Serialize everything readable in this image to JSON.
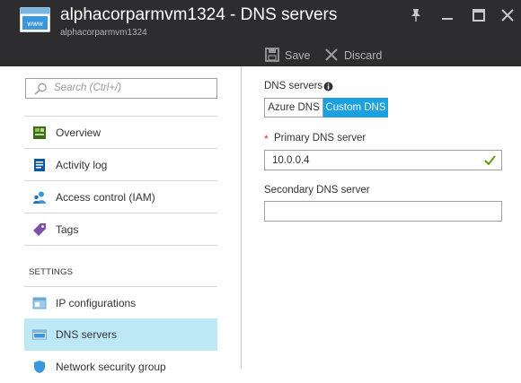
{
  "window": {
    "title": "alphacorparmvm1324 - DNS servers",
    "subtitle": "alphacorparmvm1324",
    "app_icon_text": "www"
  },
  "toolbar": {
    "save_label": "Save",
    "discard_label": "Discard"
  },
  "search": {
    "placeholder": "Search (Ctrl+/)"
  },
  "menu": {
    "items": [
      {
        "label": "Overview",
        "icon": "overview-icon"
      },
      {
        "label": "Activity log",
        "icon": "activity-log-icon"
      },
      {
        "label": "Access control (IAM)",
        "icon": "access-control-icon"
      },
      {
        "label": "Tags",
        "icon": "tag-icon"
      }
    ],
    "settings_header": "SETTINGS",
    "settings_items": [
      {
        "label": "IP configurations",
        "icon": "ip-configurations-icon"
      },
      {
        "label": "DNS servers",
        "icon": "dns-servers-icon",
        "active": true
      },
      {
        "label": "Network security group",
        "icon": "network-security-group-icon"
      }
    ]
  },
  "dns": {
    "label": "DNS servers",
    "options": [
      "Azure DNS",
      "Custom DNS"
    ],
    "selected": "Custom DNS",
    "primary_label": "Primary DNS server",
    "required_marker": "*",
    "primary_value": "10.0.0.4",
    "secondary_label": "Secondary DNS server",
    "secondary_value": ""
  },
  "colors": {
    "titlebar_bg": "#2d2d30",
    "accent": "#1ba1e2",
    "active_menu_bg": "#bde9f7",
    "valid_check": "#57a300",
    "required": "#d9342b"
  }
}
